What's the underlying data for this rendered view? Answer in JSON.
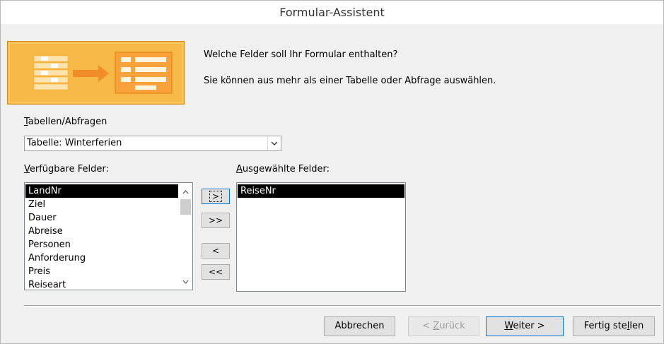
{
  "window": {
    "title": "Formular-Assistent"
  },
  "intro": {
    "line1": "Welche Felder soll Ihr Formular enthalten?",
    "line2": "Sie können aus mehr als einer Tabelle oder Abfrage auswählen."
  },
  "tables": {
    "label_accel": "T",
    "label_rest": "abellen/Abfragen",
    "selected": "Tabelle: Winterferien"
  },
  "available": {
    "label_accel": "V",
    "label_rest": "erfügbare Felder:",
    "items": [
      "LandNr",
      "Ziel",
      "Dauer",
      "Abreise",
      "Personen",
      "Anforderung",
      "Preis",
      "Reiseart"
    ],
    "selected_index": 0
  },
  "selected_fields": {
    "label_accel": "A",
    "label_rest": "usgewählte Felder:",
    "items": [
      "ReiseNr"
    ],
    "selected_index": 0
  },
  "move_buttons": {
    "add": ">",
    "add_all": ">>",
    "remove": "<",
    "remove_all": "<<"
  },
  "footer": {
    "cancel": "Abbrechen",
    "back_pre": "< ",
    "back_accel": "Z",
    "back_rest": "urück",
    "next_accel": "W",
    "next_rest": "eiter >",
    "finish_pre": "Fertig ste",
    "finish_accel": "l",
    "finish_rest": "len"
  },
  "colors": {
    "accent": "#0078d7",
    "banner": "#f7b946",
    "selection": "#000000"
  },
  "icons": {
    "dropdown": "chevron-down-icon",
    "scroll_up": "chevron-up-icon",
    "scroll_down": "chevron-down-icon"
  }
}
